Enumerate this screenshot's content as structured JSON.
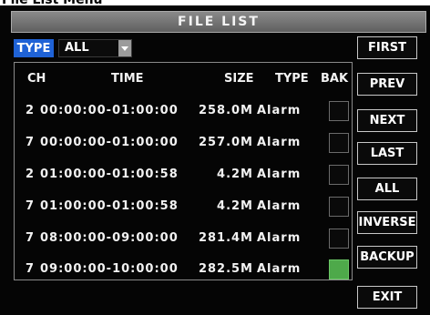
{
  "caption": "File List Menu",
  "title": "FILE LIST",
  "filter": {
    "label": "TYPE",
    "value": "ALL"
  },
  "columns": [
    "CH",
    "TIME",
    "SIZE",
    "TYPE",
    "BAK"
  ],
  "rows": [
    {
      "ch": "2",
      "time": "00:00:00-01:00:00",
      "size": "258.0M",
      "type": "Alarm",
      "bak": false
    },
    {
      "ch": "7",
      "time": "00:00:00-01:00:00",
      "size": "257.0M",
      "type": "Alarm",
      "bak": false
    },
    {
      "ch": "2",
      "time": "01:00:00-01:00:58",
      "size": "4.2M",
      "type": "Alarm",
      "bak": false
    },
    {
      "ch": "7",
      "time": "01:00:00-01:00:58",
      "size": "4.2M",
      "type": "Alarm",
      "bak": false
    },
    {
      "ch": "7",
      "time": "08:00:00-09:00:00",
      "size": "281.4M",
      "type": "Alarm",
      "bak": false
    },
    {
      "ch": "7",
      "time": "09:00:00-10:00:00",
      "size": "282.5M",
      "type": "Alarm",
      "bak": true
    }
  ],
  "buttons": {
    "first": "FIRST",
    "prev": "PREV",
    "next": "NEXT",
    "last": "LAST",
    "all": "ALL",
    "inverse": "INVERSE",
    "backup": "BACKUP",
    "exit": "EXIT"
  },
  "colors": {
    "checked": "#4ea94a",
    "type_label_bg": "#1f62d6",
    "screen_bg": "#050505"
  },
  "icons": {
    "dropdown": "chevron-down-icon"
  }
}
